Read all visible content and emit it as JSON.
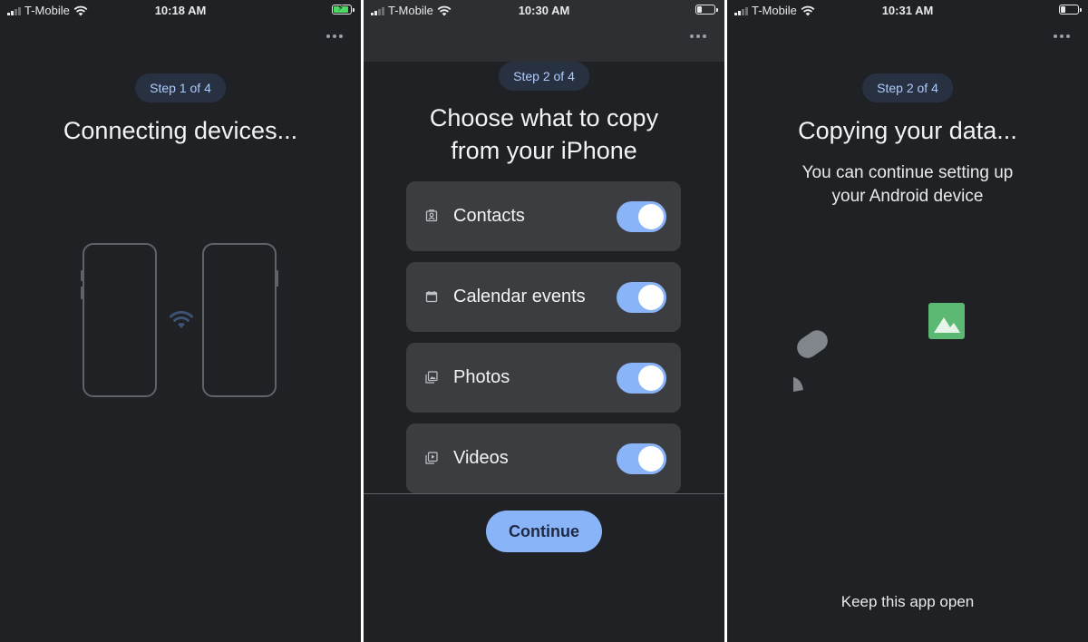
{
  "screens": [
    {
      "status": {
        "carrier": "T-Mobile",
        "time": "10:18 AM"
      },
      "step": "Step 1 of 4",
      "title": "Connecting devices..."
    },
    {
      "status": {
        "carrier": "T-Mobile",
        "time": "10:30 AM"
      },
      "step": "Step 2 of 4",
      "title_line1": "Choose what to copy",
      "title_line2": "from your iPhone",
      "items": [
        {
          "label": "Contacts",
          "icon": "contacts-icon",
          "enabled": true
        },
        {
          "label": "Calendar events",
          "icon": "calendar-icon",
          "enabled": true
        },
        {
          "label": "Photos",
          "icon": "photos-icon",
          "enabled": true
        },
        {
          "label": "Videos",
          "icon": "videos-icon",
          "enabled": true
        }
      ],
      "continue_label": "Continue"
    },
    {
      "status": {
        "carrier": "T-Mobile",
        "time": "10:31 AM"
      },
      "step": "Step 2 of 4",
      "title": "Copying your data...",
      "subtitle_line1": "You can continue setting up",
      "subtitle_line2": "your Android device",
      "footer": "Keep this app open"
    }
  ],
  "colors": {
    "background": "#202124",
    "accent": "#8ab4f8",
    "pill_bg": "#283142",
    "card_bg": "#3c3d40",
    "photo_icon": "#5bb974"
  }
}
